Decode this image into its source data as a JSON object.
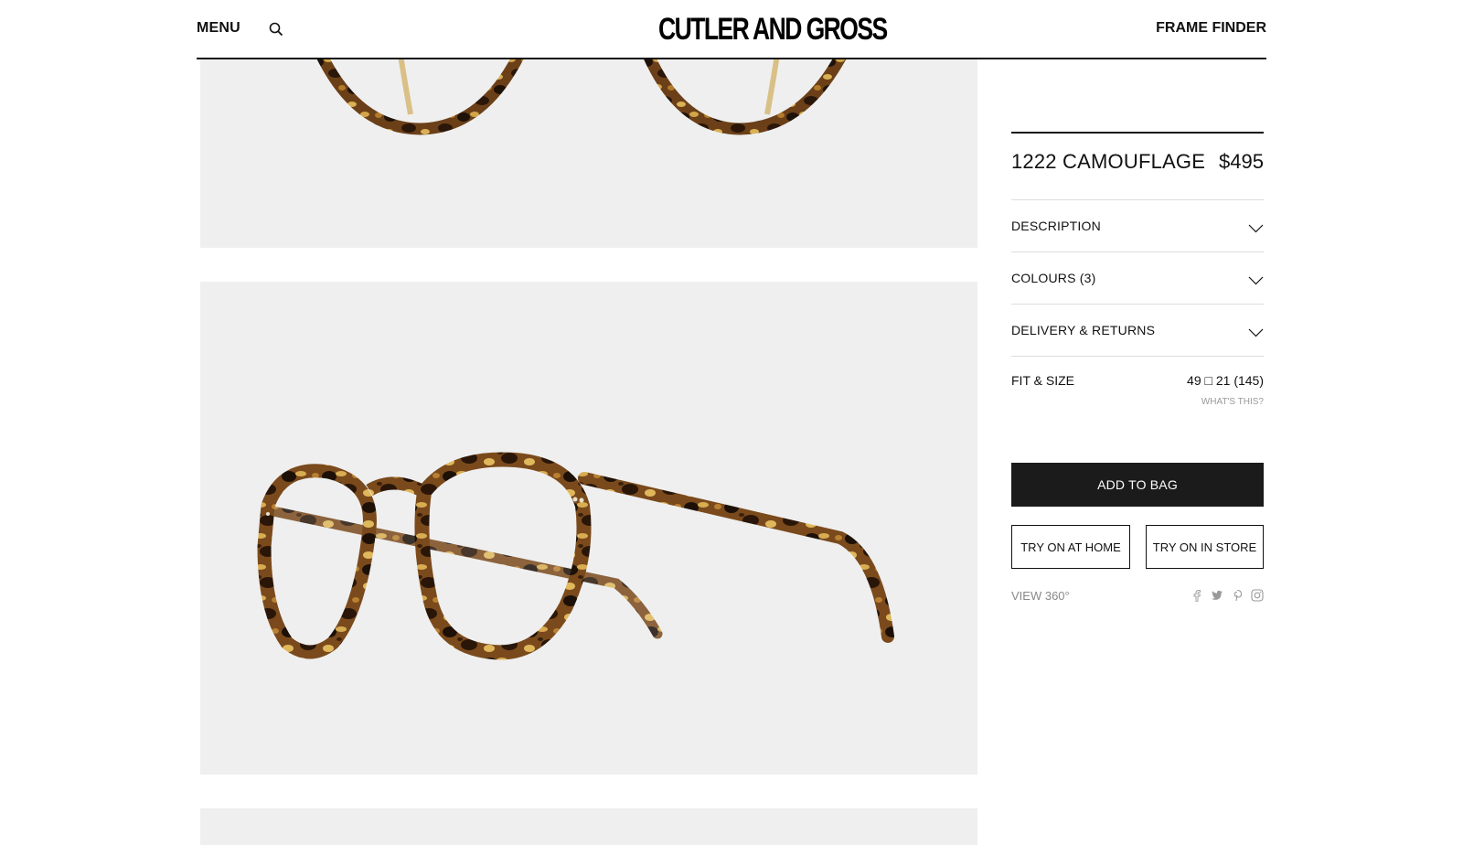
{
  "header": {
    "menu_label": "MENU",
    "logo_text": "CUTLER AND GROSS",
    "frame_finder_label": "FRAME FINDER",
    "search_icon": "search-icon"
  },
  "product": {
    "name": "1222 CAMOUFLAGE",
    "price": "$495",
    "accordion": [
      {
        "label": "DESCRIPTION",
        "icon": "chevron-down-icon"
      },
      {
        "label": "COLOURS (3)",
        "icon": "chevron-down-icon"
      },
      {
        "label": "DELIVERY & RETURNS",
        "icon": "chevron-down-icon"
      }
    ],
    "fit": {
      "label": "FIT & SIZE",
      "value": "49 □ 21 (145)",
      "help": "WHAT'S THIS?"
    },
    "add_to_bag": "ADD TO BAG",
    "try_home": "TRY ON AT HOME",
    "try_store": "TRY ON IN STORE",
    "view360": "VIEW 360°",
    "social": [
      "facebook-icon",
      "twitter-icon",
      "pinterest-icon",
      "instagram-icon"
    ]
  },
  "colors": {
    "panel_bg": "#efefef",
    "button_dark": "#1b1b1b",
    "tortoise_dark": "#3a2210",
    "tortoise_light": "#c9a040"
  }
}
